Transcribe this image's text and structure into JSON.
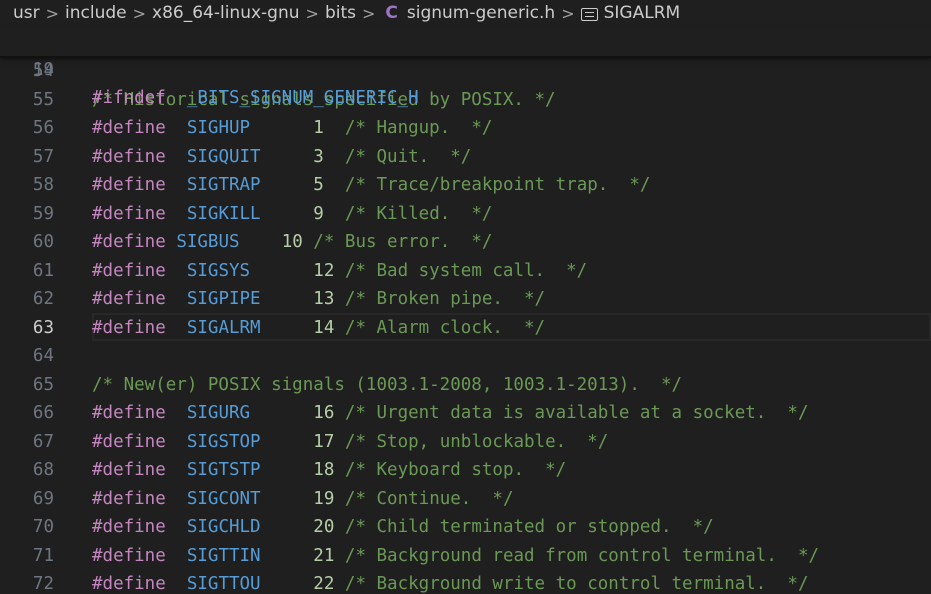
{
  "breadcrumb": {
    "items": [
      "usr",
      "include",
      "x86_64-linux-gnu",
      "bits",
      "signum-generic.h",
      "SIGALRM"
    ],
    "separator": ">",
    "file_icon": "c-file-icon",
    "symbol_icon": "symbol-constant-icon"
  },
  "sticky": {
    "line_number": "19",
    "keyword": "#ifndef",
    "symbol": "_BITS_SIGNUM_GENERIC_H"
  },
  "active_line": "63",
  "lines": [
    {
      "num": "54",
      "text": ""
    },
    {
      "num": "55",
      "comment": "/* Historical signals specified by POSIX. */"
    },
    {
      "num": "56",
      "kw": "#define",
      "pad": "  ",
      "name": "SIGHUP",
      "gap": "      ",
      "value": "1",
      "comment": "  /* Hangup.  */"
    },
    {
      "num": "57",
      "kw": "#define",
      "pad": "  ",
      "name": "SIGQUIT",
      "gap": "     ",
      "value": "3",
      "comment": "  /* Quit.  */"
    },
    {
      "num": "58",
      "kw": "#define",
      "pad": "  ",
      "name": "SIGTRAP",
      "gap": "     ",
      "value": "5",
      "comment": "  /* Trace/breakpoint trap.  */"
    },
    {
      "num": "59",
      "kw": "#define",
      "pad": "  ",
      "name": "SIGKILL",
      "gap": "     ",
      "value": "9",
      "comment": "  /* Killed.  */"
    },
    {
      "num": "60",
      "kw": "#define",
      "pad": " ",
      "name": "SIGBUS",
      "gap": "    ",
      "value": "10",
      "comment": " /* Bus error.  */"
    },
    {
      "num": "61",
      "kw": "#define",
      "pad": "  ",
      "name": "SIGSYS",
      "gap": "      ",
      "value": "12",
      "comment": " /* Bad system call.  */"
    },
    {
      "num": "62",
      "kw": "#define",
      "pad": "  ",
      "name": "SIGPIPE",
      "gap": "     ",
      "value": "13",
      "comment": " /* Broken pipe.  */"
    },
    {
      "num": "63",
      "kw": "#define",
      "pad": "  ",
      "name": "SIGALRM",
      "gap": "     ",
      "value": "14",
      "comment": " /* Alarm clock.  */"
    },
    {
      "num": "64",
      "text": ""
    },
    {
      "num": "65",
      "comment": "/* New(er) POSIX signals (1003.1-2008, 1003.1-2013).  */"
    },
    {
      "num": "66",
      "kw": "#define",
      "pad": "  ",
      "name": "SIGURG",
      "gap": "      ",
      "value": "16",
      "comment": " /* Urgent data is available at a socket.  */"
    },
    {
      "num": "67",
      "kw": "#define",
      "pad": "  ",
      "name": "SIGSTOP",
      "gap": "     ",
      "value": "17",
      "comment": " /* Stop, unblockable.  */"
    },
    {
      "num": "68",
      "kw": "#define",
      "pad": "  ",
      "name": "SIGTSTP",
      "gap": "     ",
      "value": "18",
      "comment": " /* Keyboard stop.  */"
    },
    {
      "num": "69",
      "kw": "#define",
      "pad": "  ",
      "name": "SIGCONT",
      "gap": "     ",
      "value": "19",
      "comment": " /* Continue.  */"
    },
    {
      "num": "70",
      "kw": "#define",
      "pad": "  ",
      "name": "SIGCHLD",
      "gap": "     ",
      "value": "20",
      "comment": " /* Child terminated or stopped.  */"
    },
    {
      "num": "71",
      "kw": "#define",
      "pad": "  ",
      "name": "SIGTTIN",
      "gap": "     ",
      "value": "21",
      "comment": " /* Background read from control terminal.  */"
    },
    {
      "num": "72",
      "kw": "#define",
      "pad": "  ",
      "name": "SIGTTOU",
      "gap": "     ",
      "value": "22",
      "comment": " /* Background write to control terminal.  */"
    }
  ],
  "colors": {
    "background": "#1f1f1f",
    "keyword": "#c586c0",
    "macro": "#569cd6",
    "number": "#b5cea8",
    "comment": "#6a9955",
    "gutter": "#6e7681"
  }
}
